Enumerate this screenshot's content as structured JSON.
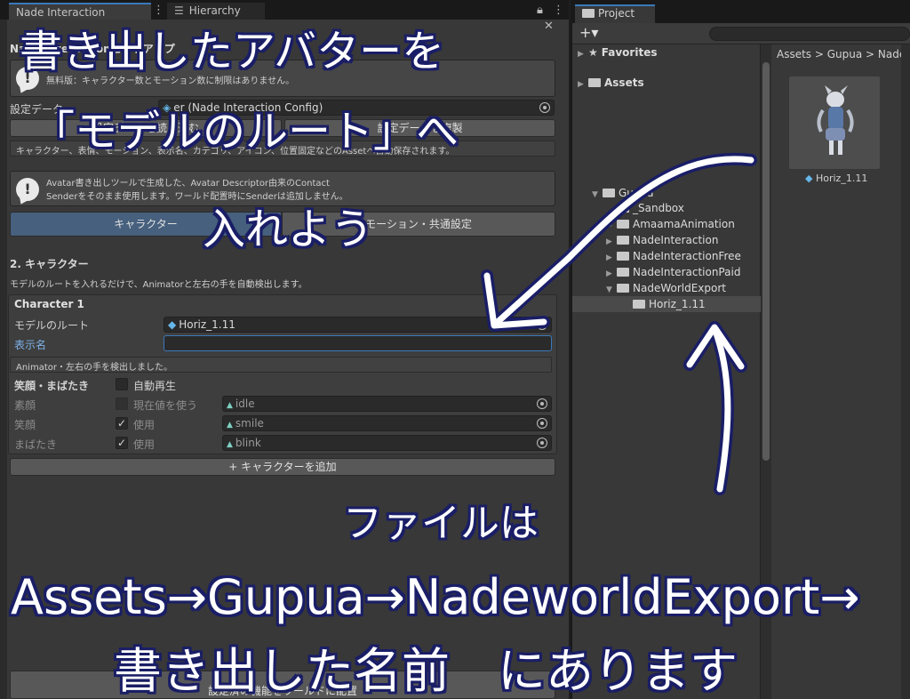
{
  "tabs": {
    "main": "Nade Interaction",
    "hierarchy": "Hierarchy",
    "project": "Project"
  },
  "inspector": {
    "title": "Nade Interactionセットアップ",
    "help1": "無料版：キャラクター数とモーション数に制限はありません。",
    "config_label": "設定データ",
    "config_value": "er (Nade Interaction Config)",
    "btn_load": "設定データを読み込む",
    "btn_duplicate": "設定データを複製",
    "info_line": "キャラクター、表情、モーション、表示名、カテゴリ、アイコン、位置固定などのAssetへ自動保存されます。",
    "help2_line1": "Avatar書き出しツールで生成した、Avatar Descriptor由来のContact",
    "help2_line2": "Senderをそのまま使用します。ワールド配置時にSenderは追加しません。",
    "tab_character": "キャラクター",
    "tab_motion": "モーション・共通設定",
    "section_title": "2. キャラクター",
    "section_desc": "モデルのルートを入れるだけで、Animatorと左右の手を自動検出します。",
    "character": {
      "title": "Character 1",
      "root_label": "モデルのルート",
      "root_value": "Horiz_1.11",
      "display_name_label": "表示名",
      "display_name_value": "",
      "detect_status": "Animator・左右の手を検出しました。",
      "expr_header": "笑顔・まばたき",
      "autoplay_label": "自動再生",
      "rows": [
        {
          "label": "素顔",
          "check_label": "現在値を使う",
          "checked": false,
          "clip": "idle"
        },
        {
          "label": "笑顔",
          "check_label": "使用",
          "checked": true,
          "clip": "smile"
        },
        {
          "label": "まばたき",
          "check_label": "使用",
          "checked": true,
          "clip": "blink"
        }
      ]
    },
    "add_character": "+ キャラクターを追加",
    "bottom_button": "設定済の機能をワールドに配置"
  },
  "project": {
    "breadcrumb": "Assets > Gupua > Nade",
    "tree": {
      "favorites": "Favorites",
      "assets": "Assets",
      "gupua": "Gupua",
      "children": [
        "_Sandbox",
        "AmaamaAnimation",
        "NadeInteraction",
        "NadeInteractionFree",
        "NadeInteractionPaid",
        "NadeWorldExport"
      ],
      "selected": "Horiz_1.11"
    },
    "asset_name": "Horiz_1.11"
  },
  "annotation": {
    "line1": "書き出したアバターを",
    "line2": "「モデルのルート」へ",
    "line3": "入れよう",
    "line4": "ファイルは",
    "line5": "Assets→Gupua→NadeworldExport→",
    "line6": "書き出した名前　にあります"
  }
}
